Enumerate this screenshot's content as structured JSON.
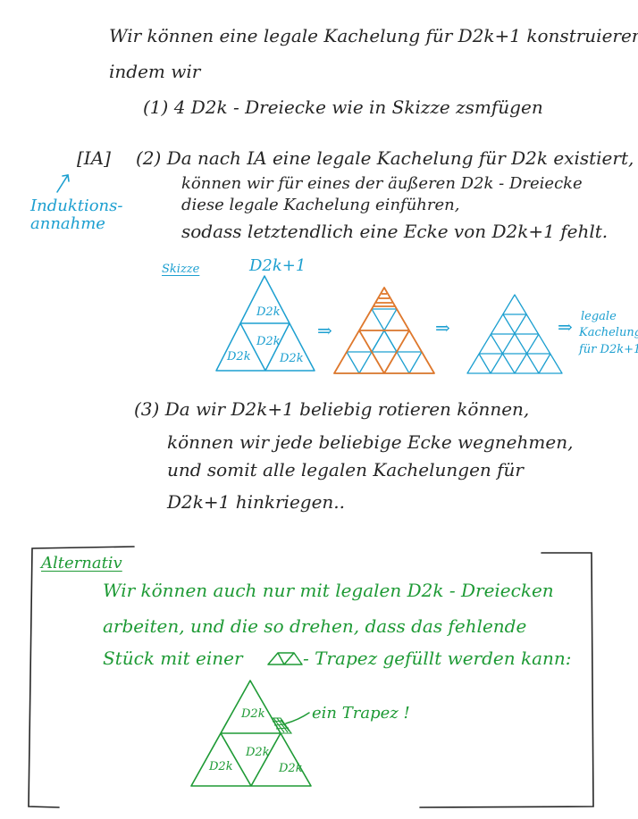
{
  "intro": {
    "line1": "Wir können eine legale Kachelung für D2k+1 konstruieren,",
    "line2": "indem wir"
  },
  "steps": {
    "step1": "(1) 4 D2k - Dreiecke wie in Skizze zsmfügen",
    "ia_tag": "[IA]",
    "step2_line1": "(2) Da nach IA eine legale Kachelung für D2k existiert,",
    "step2_line2": "können wir für eines der äußeren D2k - Dreiecke",
    "step2_line3": "diese legale Kachelung einführen,",
    "step2_line4": "sodass letztendlich eine Ecke von D2k+1 fehlt.",
    "ia_note_line1": "Induktions-",
    "ia_note_line2": "annahme"
  },
  "sketch": {
    "heading": "Skizze",
    "top_label": "D2k+1",
    "tri_top": "D2k",
    "tri_center": "D2k",
    "tri_left": "D2k",
    "tri_right": "D2k",
    "arrow1": "⇒",
    "arrow2": "⇒",
    "arrow3": "⇒",
    "result_line1": "legale",
    "result_line2": "Kachelung",
    "result_line3": "für D2k+1"
  },
  "step3": {
    "line1": "(3) Da wir D2k+1 beliebig rotieren können,",
    "line2": "können wir jede beliebige Ecke wegnehmen,",
    "line3": "und somit alle legalen Kachelungen für",
    "line4": "D2k+1 hinkriegen.."
  },
  "alternative": {
    "title": "Alternativ",
    "line1": "Wir können auch nur mit legalen D2k - Dreiecken",
    "line2": "arbeiten, und die so drehen, dass das fehlende",
    "line3_start": "Stück mit einer",
    "line3_end": "- Trapez gefüllt werden kann:",
    "tri_top": "D2k",
    "tri_center": "D2k",
    "tri_left": "D2k",
    "tri_right": "D2k",
    "trapez_note": "ein Trapez !"
  },
  "colors": {
    "ink": "#262626",
    "blue": "#1c9fd0",
    "orange": "#e0782c",
    "green": "#1e9a35"
  }
}
